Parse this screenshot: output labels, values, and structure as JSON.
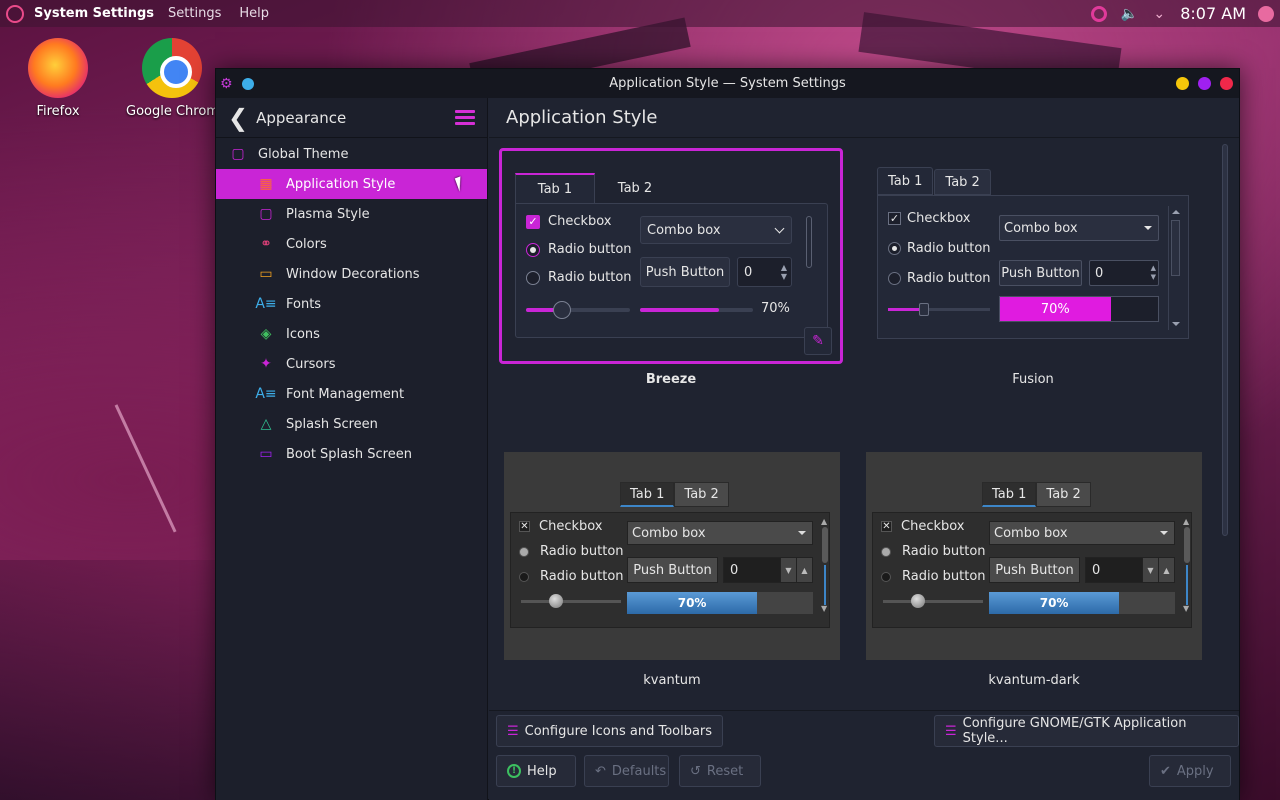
{
  "panel": {
    "app_name": "System Settings",
    "menus": [
      "Settings",
      "Help"
    ],
    "clock": "8:07 AM"
  },
  "desktop": {
    "icons": [
      {
        "label": "Firefox",
        "icon": "firefox-icon"
      },
      {
        "label": "Google Chrom",
        "icon": "chrome-icon"
      }
    ]
  },
  "window": {
    "title": "Application Style — System Settings"
  },
  "sidebar": {
    "title": "Appearance",
    "items": [
      {
        "label": "Global Theme",
        "icon": "global-theme-icon",
        "color": "#c925d6"
      },
      {
        "label": "Application Style",
        "icon": "application-style-icon",
        "color": "#ff6a30"
      },
      {
        "label": "Plasma Style",
        "icon": "plasma-style-icon",
        "color": "#c925d6"
      },
      {
        "label": "Colors",
        "icon": "colors-icon",
        "color": "#e0407a"
      },
      {
        "label": "Window Decorations",
        "icon": "window-decorations-icon",
        "color": "#f0a020"
      },
      {
        "label": "Fonts",
        "icon": "fonts-icon",
        "color": "#3daee9"
      },
      {
        "label": "Icons",
        "icon": "icons-icon",
        "color": "#40c060"
      },
      {
        "label": "Cursors",
        "icon": "cursors-icon",
        "color": "#c925d6"
      },
      {
        "label": "Font Management",
        "icon": "font-management-icon",
        "color": "#3daee9"
      },
      {
        "label": "Splash Screen",
        "icon": "splash-screen-icon",
        "color": "#30c090"
      },
      {
        "label": "Boot Splash Screen",
        "icon": "boot-splash-screen-icon",
        "color": "#a020f0"
      }
    ],
    "active_index": 1
  },
  "content": {
    "title": "Application Style"
  },
  "previews": {
    "breeze": {
      "name": "Breeze",
      "tab1": "Tab 1",
      "tab2": "Tab 2",
      "checkbox": "Checkbox",
      "radio1": "Radio button",
      "radio2": "Radio button",
      "combo": "Combo box",
      "push": "Push Button",
      "spin": "0",
      "progress_text": "70%",
      "progress": 0.7,
      "slider": 0.35
    },
    "fusion": {
      "name": "Fusion",
      "tab1": "Tab 1",
      "tab2": "Tab 2",
      "checkbox": "Checkbox",
      "radio1": "Radio button",
      "radio2": "Radio button",
      "combo": "Combo box",
      "push": "Push Button",
      "spin": "0",
      "progress_text": "70%",
      "progress": 0.7,
      "slider": 0.35
    },
    "kvantum": {
      "name": "kvantum",
      "tab1": "Tab 1",
      "tab2": "Tab 2",
      "checkbox": "Checkbox",
      "radio1": "Radio button",
      "radio2": "Radio button",
      "combo": "Combo box",
      "push": "Push Button",
      "spin": "0",
      "progress_text": "70%",
      "progress": 0.7,
      "slider": 0.35
    },
    "kvantum_dark": {
      "name": "kvantum-dark",
      "tab1": "Tab 1",
      "tab2": "Tab 2",
      "checkbox": "Checkbox",
      "radio1": "Radio button",
      "radio2": "Radio button",
      "combo": "Combo box",
      "push": "Push Button",
      "spin": "0",
      "progress_text": "70%",
      "progress": 0.7,
      "slider": 0.35
    }
  },
  "footer": {
    "configure_icons": "Configure Icons and Toolbars",
    "configure_gtk": "Configure GNOME/GTK Application Style...",
    "help": "Help",
    "defaults": "Defaults",
    "reset": "Reset",
    "apply": "Apply"
  },
  "colors": {
    "accent": "#c925d6",
    "window_bg": "#1f2330",
    "kvantum_accent": "#3d86c8"
  }
}
